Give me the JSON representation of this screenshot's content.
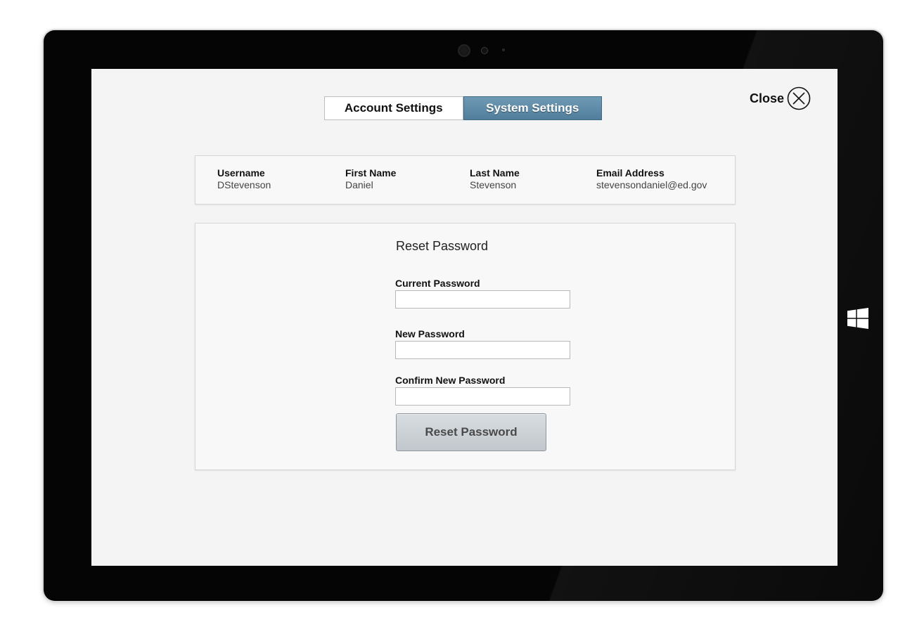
{
  "tabs": [
    {
      "label": "Account Settings",
      "active": false
    },
    {
      "label": "System Settings",
      "active": true
    }
  ],
  "close": {
    "label": "Close",
    "icon": "close-circle-icon"
  },
  "account": {
    "username": {
      "label": "Username",
      "value": "DStevenson"
    },
    "first_name": {
      "label": "First Name",
      "value": "Daniel"
    },
    "last_name": {
      "label": "Last Name",
      "value": "Stevenson"
    },
    "email": {
      "label": "Email Address",
      "value": "stevensondaniel@ed.gov"
    }
  },
  "reset_password": {
    "title": "Reset Password",
    "current_password": {
      "label": "Current Password",
      "value": ""
    },
    "new_password": {
      "label": "New Password",
      "value": ""
    },
    "confirm_password": {
      "label": "Confirm New Password",
      "value": ""
    },
    "button_label": "Reset Password"
  },
  "colors": {
    "active_tab": "#5a87a4",
    "screen_background": "#f4f4f4",
    "device_bezel": "#050505"
  },
  "device": {
    "hardware_button_icon": "windows-logo-icon"
  }
}
